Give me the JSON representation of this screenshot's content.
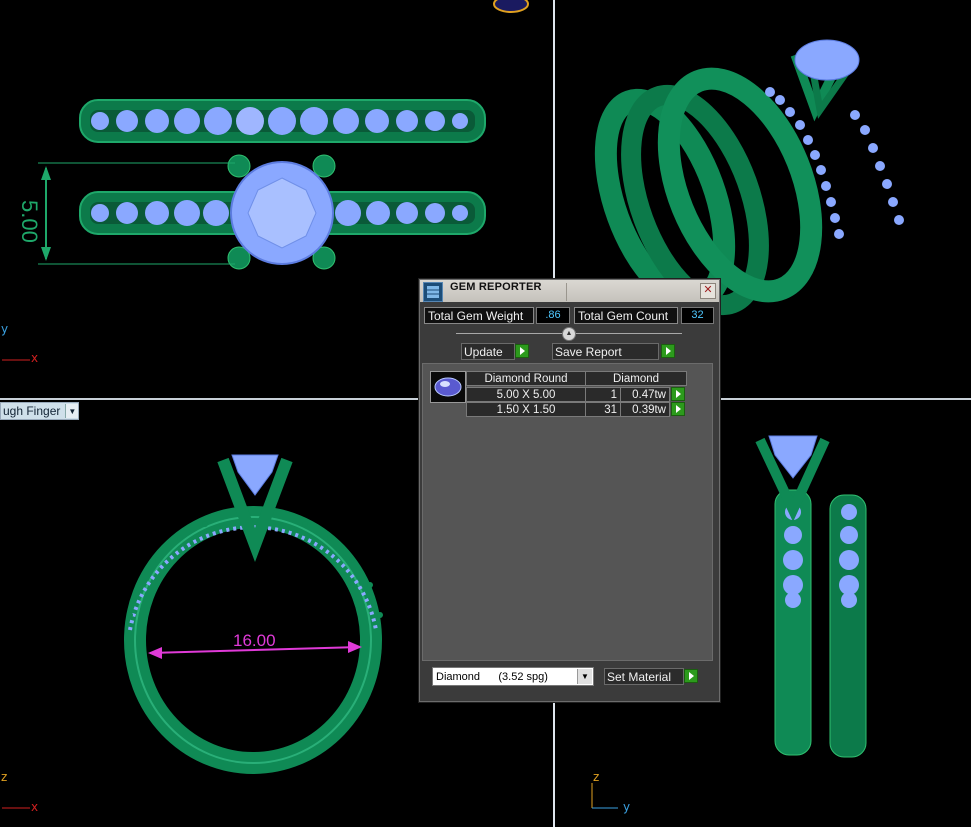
{
  "viewports": {
    "top_left": {
      "dimension": "5.00",
      "axis_y": "y",
      "axis_x": "x"
    },
    "bottom_left": {
      "dimension": "16.00",
      "axis_z": "z",
      "axis_x": "x",
      "finger_dropdown": "ugh Finger"
    },
    "bottom_right": {
      "axis_z": "z",
      "axis_y": "y"
    }
  },
  "gem_reporter": {
    "title": "GEM REPORTER",
    "total_weight_label": "Total Gem Weight",
    "total_weight_value": ".86",
    "total_count_label": "Total Gem Count",
    "total_count_value": "32",
    "update_label": "Update",
    "save_report_label": "Save Report",
    "table": {
      "headers": [
        "Diamond Round",
        "Diamond"
      ],
      "rows": [
        {
          "size": "5.00 X 5.00",
          "count": "1",
          "weight": "0.47tw"
        },
        {
          "size": "1.50 X 1.50",
          "count": "31",
          "weight": "0.39tw"
        }
      ]
    },
    "material_select": "Diamond      (3.52 spg)",
    "set_material_label": "Set Material"
  },
  "colors": {
    "ring_green": "#0f8a55",
    "gem_blue": "#8aa8ff",
    "dimension_magenta": "#e03ad8",
    "axis_red": "#d02020",
    "axis_blue": "#3aa0e0"
  }
}
